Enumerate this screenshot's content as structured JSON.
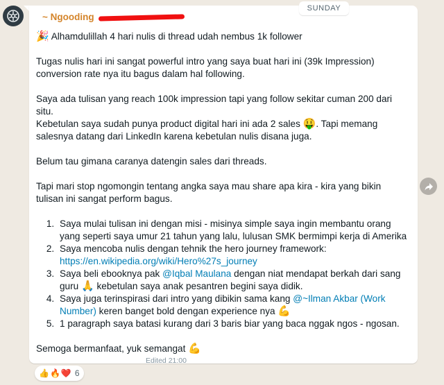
{
  "date_chip": "SUNDAY",
  "sender": {
    "name": "~ Ngooding"
  },
  "message": {
    "intro_emoji": "🎉",
    "p1": "Alhamdulillah 4 hari nulis di thread udah nembus 1k follower",
    "p2": "Tugas nulis hari ini sangat powerful intro yang saya buat hari ini (39k Impression) conversion rate nya itu bagus dalam hal following.",
    "p3a": "Saya ada tulisan yang reach 100k impression tapi yang follow sekitar cuman 200 dari situ.",
    "p3b_pre": "Kebetulan saya sudah punya product digital hari ini ada 2 sales",
    "p3b_emoji": "🤑",
    "p3b_post": ". Tapi memang salesnya datang dari LinkedIn karena kebetulan nulis disana juga.",
    "p4": "Belum tau gimana caranya datengin sales dari threads.",
    "p5": "Tapi mari stop ngomongin tentang angka saya mau share apa kira - kira yang bikin tulisan ini sangat perform bagus.",
    "list": {
      "i1": "Saya mulai tulisan ini dengan misi - misinya simple saya ingin membantu orang yang seperti saya umur 21 tahun yang lalu, lulusan SMK bermimpi kerja di Amerika",
      "i2_text": "Saya mencoba nulis dengan tehnik the hero journey framework:",
      "i2_link": "https://en.wikipedia.org/wiki/Hero%27s_journey",
      "i3_pre": "Saya beli ebooknya pak",
      "i3_mention": "@Iqbal Maulana",
      "i3_mid": "dengan niat mendapat berkah dari sang guru",
      "i3_emoji": "🙏",
      "i3_post": "kebetulan saya anak pesantren begini saya didik.",
      "i4_pre": "Saya juga terinspirasi dari intro yang dibikin sama kang",
      "i4_mention": "@~Ilman Akbar (Work Number)",
      "i4_post": "keren banget bold dengan experience nya",
      "i4_emoji": "💪",
      "i5": "1 paragraph saya batasi kurang dari 3 baris biar yang baca nggak ngos - ngosan."
    },
    "closing": "Semoga bermanfaat, yuk semangat",
    "closing_emoji": "💪"
  },
  "meta": "Edited 21:00",
  "reactions": {
    "emojis": [
      "👍",
      "🔥",
      "❤️"
    ],
    "count": "6"
  },
  "colors": {
    "sender": "#d4842a",
    "link": "#027eb5",
    "background": "#efeae2",
    "redaction": "#f01010"
  },
  "icons": {
    "avatar": "group-avatar-icon",
    "forward": "forward-icon"
  }
}
